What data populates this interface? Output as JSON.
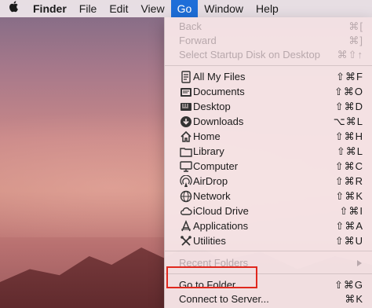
{
  "menubar": {
    "apple_icon": "apple-logo-icon",
    "items": [
      "Finder",
      "File",
      "Edit",
      "View",
      "Go",
      "Window",
      "Help"
    ],
    "active": "Go"
  },
  "go_menu": {
    "history": [
      {
        "label": "Back",
        "shortcut": "⌘[",
        "enabled": false
      },
      {
        "label": "Forward",
        "shortcut": "⌘]",
        "enabled": false
      },
      {
        "label": "Select Startup Disk on Desktop",
        "shortcut": "⌘⇧↑",
        "enabled": false
      }
    ],
    "places": [
      {
        "label": "All My Files",
        "shortcut": "⇧⌘F",
        "icon": "all-files-icon"
      },
      {
        "label": "Documents",
        "shortcut": "⇧⌘O",
        "icon": "documents-icon"
      },
      {
        "label": "Desktop",
        "shortcut": "⇧⌘D",
        "icon": "desktop-icon"
      },
      {
        "label": "Downloads",
        "shortcut": "⌥⌘L",
        "icon": "downloads-icon"
      },
      {
        "label": "Home",
        "shortcut": "⇧⌘H",
        "icon": "home-icon"
      },
      {
        "label": "Library",
        "shortcut": "⇧⌘L",
        "icon": "library-icon"
      },
      {
        "label": "Computer",
        "shortcut": "⇧⌘C",
        "icon": "computer-icon"
      },
      {
        "label": "AirDrop",
        "shortcut": "⇧⌘R",
        "icon": "airdrop-icon"
      },
      {
        "label": "Network",
        "shortcut": "⇧⌘K",
        "icon": "network-icon"
      },
      {
        "label": "iCloud Drive",
        "shortcut": "⇧⌘I",
        "icon": "icloud-icon"
      },
      {
        "label": "Applications",
        "shortcut": "⇧⌘A",
        "icon": "applications-icon"
      },
      {
        "label": "Utilities",
        "shortcut": "⇧⌘U",
        "icon": "utilities-icon"
      }
    ],
    "recent_folders": {
      "label": "Recent Folders",
      "enabled": false
    },
    "actions": [
      {
        "label": "Go to Folder...",
        "shortcut": "⇧⌘G"
      },
      {
        "label": "Connect to Server...",
        "shortcut": "⌘K"
      }
    ]
  },
  "colors": {
    "accent": "#1e6ed8",
    "highlight_box": "#e0281e",
    "disabled_text": "#b8a8ac"
  }
}
